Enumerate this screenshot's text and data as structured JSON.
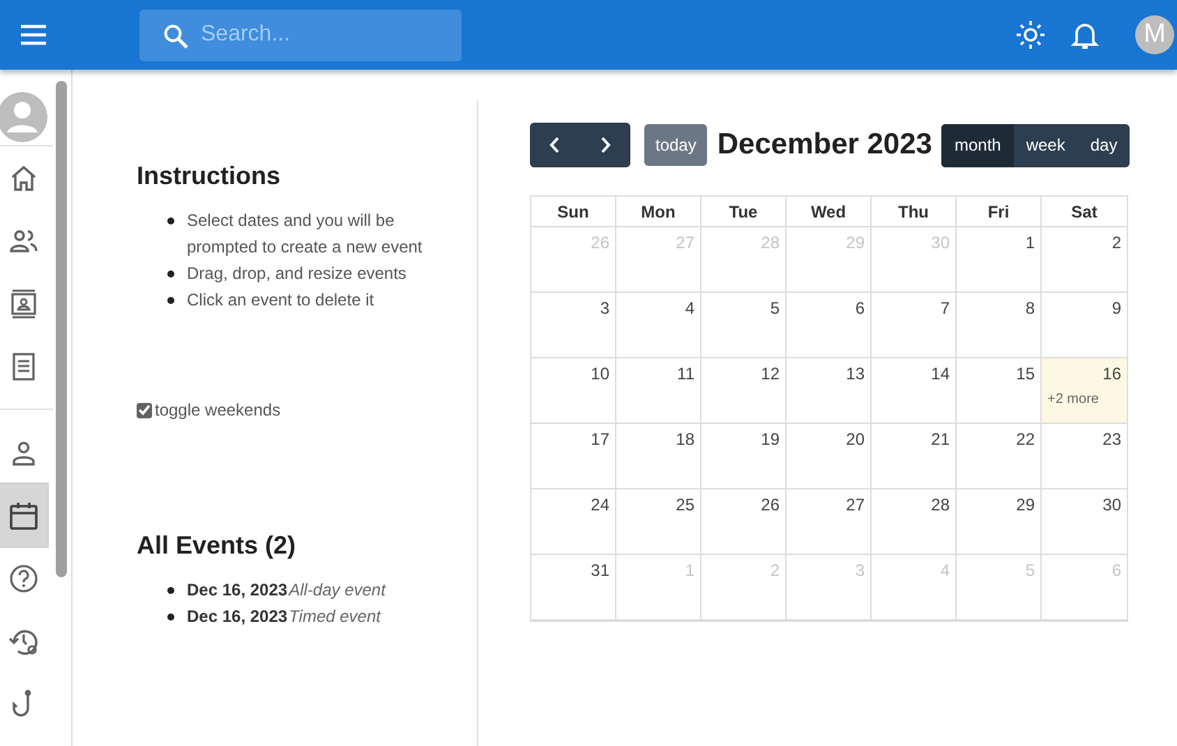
{
  "topbar": {
    "search": {
      "placeholder": "Search..."
    },
    "avatar": "M"
  },
  "sidebar": {
    "groups": [
      {
        "items": [
          {
            "kind": "home",
            "selected": false
          },
          {
            "kind": "people",
            "selected": false
          },
          {
            "kind": "contact",
            "selected": false
          },
          {
            "kind": "list",
            "selected": false
          }
        ]
      },
      {
        "items": [
          {
            "kind": "person",
            "selected": false
          },
          {
            "kind": "calendar",
            "selected": true
          },
          {
            "kind": "help",
            "selected": false
          },
          {
            "kind": "history",
            "selected": false
          },
          {
            "kind": "hook",
            "selected": false
          }
        ]
      }
    ]
  },
  "instructions": {
    "title": "Instructions",
    "items": [
      "Select dates and you will be prompted to create a new event",
      "Drag, drop, and resize events",
      "Click an event to delete it"
    ]
  },
  "toggle": {
    "label": "toggle weekends",
    "checked": true
  },
  "events": {
    "title": "All Events (2)",
    "items": [
      {
        "date": "Dec 16, 2023",
        "title": "All-day event"
      },
      {
        "date": "Dec 16, 2023",
        "title": "Timed event"
      }
    ]
  },
  "calendar": {
    "title": "December 2023",
    "today_button": {
      "label": "today",
      "disabled": true
    },
    "views": [
      {
        "label": "month",
        "selected": true
      },
      {
        "label": "week",
        "selected": false
      },
      {
        "label": "day",
        "selected": false
      }
    ],
    "weekdays": [
      "Sun",
      "Mon",
      "Tue",
      "Wed",
      "Thu",
      "Fri",
      "Sat"
    ],
    "weeks": [
      [
        {
          "day": "26",
          "other_month": true
        },
        {
          "day": "27",
          "other_month": true
        },
        {
          "day": "28",
          "other_month": true
        },
        {
          "day": "29",
          "other_month": true
        },
        {
          "day": "30",
          "other_month": true
        },
        {
          "day": "1",
          "other_month": false
        },
        {
          "day": "2",
          "other_month": false
        }
      ],
      [
        {
          "day": "3",
          "other_month": false
        },
        {
          "day": "4",
          "other_month": false
        },
        {
          "day": "5",
          "other_month": false
        },
        {
          "day": "6",
          "other_month": false
        },
        {
          "day": "7",
          "other_month": false
        },
        {
          "day": "8",
          "other_month": false
        },
        {
          "day": "9",
          "other_month": false
        }
      ],
      [
        {
          "day": "10",
          "other_month": false
        },
        {
          "day": "11",
          "other_month": false
        },
        {
          "day": "12",
          "other_month": false
        },
        {
          "day": "13",
          "other_month": false
        },
        {
          "day": "14",
          "other_month": false
        },
        {
          "day": "15",
          "other_month": false
        },
        {
          "day": "16",
          "other_month": false,
          "today": true,
          "more": "+2 more"
        }
      ],
      [
        {
          "day": "17",
          "other_month": false
        },
        {
          "day": "18",
          "other_month": false
        },
        {
          "day": "19",
          "other_month": false
        },
        {
          "day": "20",
          "other_month": false
        },
        {
          "day": "21",
          "other_month": false
        },
        {
          "day": "22",
          "other_month": false
        },
        {
          "day": "23",
          "other_month": false
        }
      ],
      [
        {
          "day": "24",
          "other_month": false
        },
        {
          "day": "25",
          "other_month": false
        },
        {
          "day": "26",
          "other_month": false
        },
        {
          "day": "27",
          "other_month": false
        },
        {
          "day": "28",
          "other_month": false
        },
        {
          "day": "29",
          "other_month": false
        },
        {
          "day": "30",
          "other_month": false
        }
      ],
      [
        {
          "day": "31",
          "other_month": false
        },
        {
          "day": "1",
          "other_month": true
        },
        {
          "day": "2",
          "other_month": true
        },
        {
          "day": "3",
          "other_month": true
        },
        {
          "day": "4",
          "other_month": true
        },
        {
          "day": "5",
          "other_month": true
        },
        {
          "day": "6",
          "other_month": true
        }
      ]
    ]
  }
}
